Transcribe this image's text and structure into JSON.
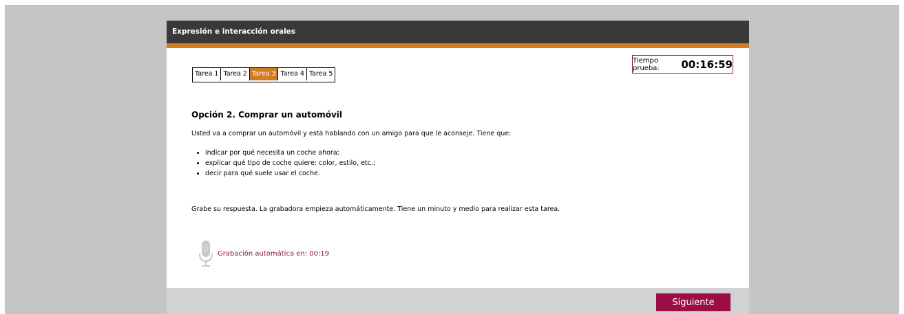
{
  "window": {
    "title": "Expresión e interacción orales"
  },
  "tabs": [
    {
      "label": "Tarea 1"
    },
    {
      "label": "Tarea 2"
    },
    {
      "label": "Tarea 3",
      "active": true
    },
    {
      "label": "Tarea 4"
    },
    {
      "label": "Tarea 5"
    }
  ],
  "timer": {
    "label": "Tiempo prueba:",
    "value": "00:16:59"
  },
  "task": {
    "heading": "Opción 2. Comprar un automóvil",
    "intro": "Usted va a comprar un automóvil y está hablando con un amigo para que le aconseje. Tiene que:",
    "bullets": [
      "indicar por qué necesita un coche ahora;",
      "explicar qué tipo de coche quiere: color, estilo, etc.;",
      "decir para qué suele usar el coche."
    ],
    "instruction": "Grabe su respuesta. La grabadora empieza automáticamente. Tiene un minuto y medio para realizar esta tarea."
  },
  "recorder": {
    "icon": "microphone-icon",
    "text": "Grabación automática en: 00:19"
  },
  "footer": {
    "next_label": "Siguiente"
  },
  "colors": {
    "accent": "#d17c23",
    "brand": "#9c0d45",
    "titlebar": "#393939"
  }
}
